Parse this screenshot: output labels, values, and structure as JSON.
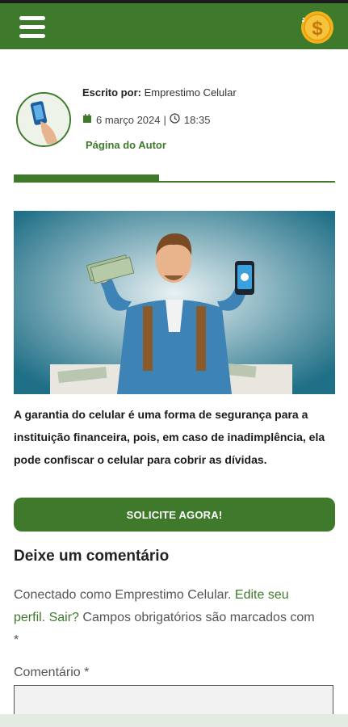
{
  "header": {
    "menu_icon": "hamburger-menu-icon",
    "coin_icon": "dollar-coin-icon",
    "colors": {
      "brand": "#3f7a2c",
      "coin": "#f5b21b"
    }
  },
  "author": {
    "written_by_label": "Escrito por:",
    "author_name": "Emprestimo Celular",
    "date": "6 março 2024",
    "separator": "|",
    "time": "18:35",
    "author_page_link": "Página do Autor"
  },
  "article": {
    "body": "A garantia do celular é uma forma de segurança para a instituição financeira, pois, em caso de inadimplência, ela pode confiscar o celular para cobrir as dívidas.",
    "cta_label": "SOLICITE AGORA!"
  },
  "comments": {
    "title": "Deixe um comentário",
    "logged_prefix": "Conectado como Emprestimo Celular.",
    "edit_link": "Edite seu perfil.",
    "logout_link": "Sair?",
    "required_note": "Campos obrigatórios são marcados com *",
    "comment_label": "Comentário *"
  }
}
